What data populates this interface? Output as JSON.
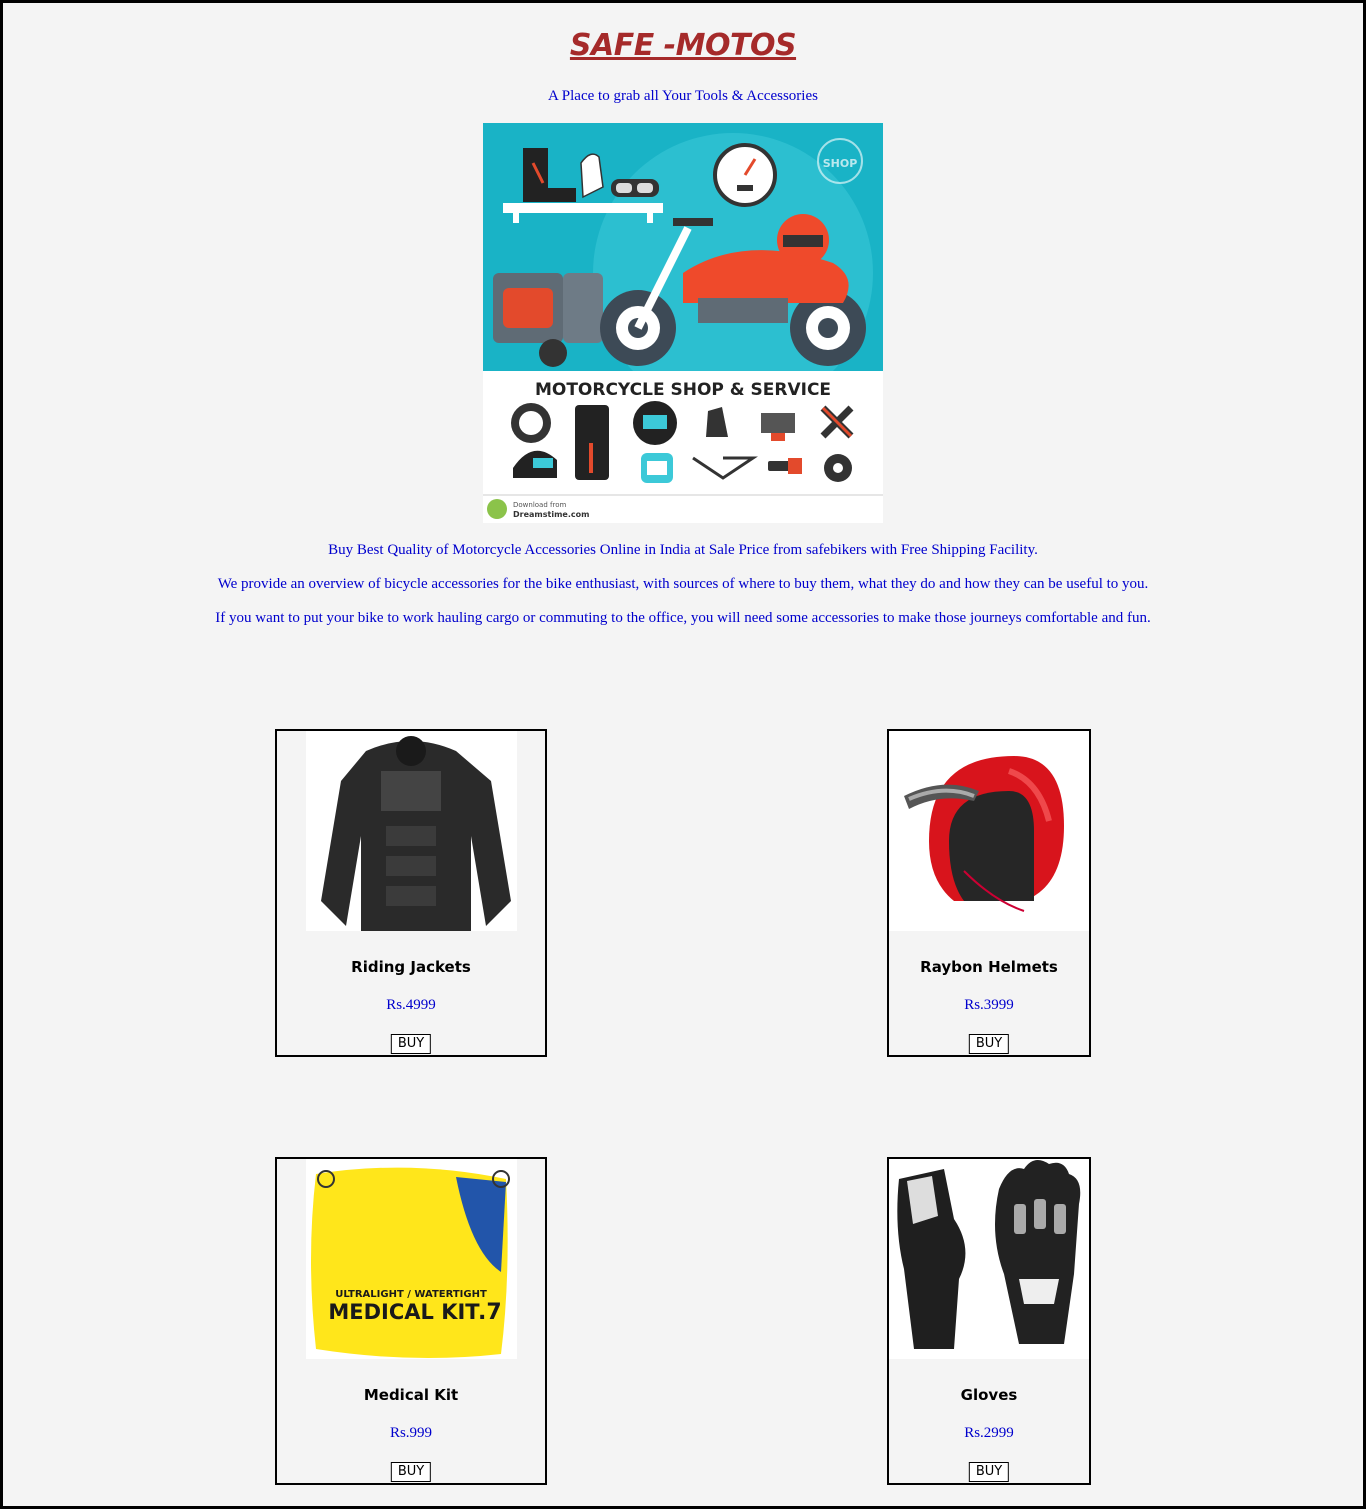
{
  "header": {
    "title": "SAFE -MOTOS",
    "tagline": "A Place to grab all Your Tools & Accessories"
  },
  "hero": {
    "banner_text": "MOTORCYCLE SHOP & SERVICE",
    "shop_sign": "SHOP",
    "credit_line": "Download from",
    "credit_site": "Dreamstime.com"
  },
  "description": [
    "Buy Best Quality of Motorcycle Accessories Online in India at Sale Price from safebikers with Free Shipping Facility.",
    "We provide an overview of bicycle accessories for the bike enthusiast, with sources of where to buy them, what they do and how they can be useful to you.",
    "If you want to put your bike to work hauling cargo or commuting to the office, you will need some accessories to make those journeys comfortable and fun."
  ],
  "products": [
    {
      "name": "Riding Jackets",
      "price": "Rs.4999",
      "button": "BUY",
      "image": "jacket-icon"
    },
    {
      "name": "Raybon Helmets",
      "price": "Rs.3999",
      "button": "BUY",
      "image": "helmet-icon"
    },
    {
      "name": "Medical Kit",
      "price": "Rs.999",
      "button": "BUY",
      "image": "medical-kit-icon",
      "image_text": [
        "ULTRALIGHT / WATERTIGHT",
        "MEDICAL KIT",
        ".7"
      ]
    },
    {
      "name": "Gloves",
      "price": "Rs.2999",
      "button": "BUY",
      "image": "gloves-icon"
    }
  ],
  "colors": {
    "title": "#a52a2a",
    "text": "#0000cd",
    "background": "#f4f4f4",
    "hero_teal": "#1cb5c7",
    "bike_red": "#ef4a2b"
  }
}
